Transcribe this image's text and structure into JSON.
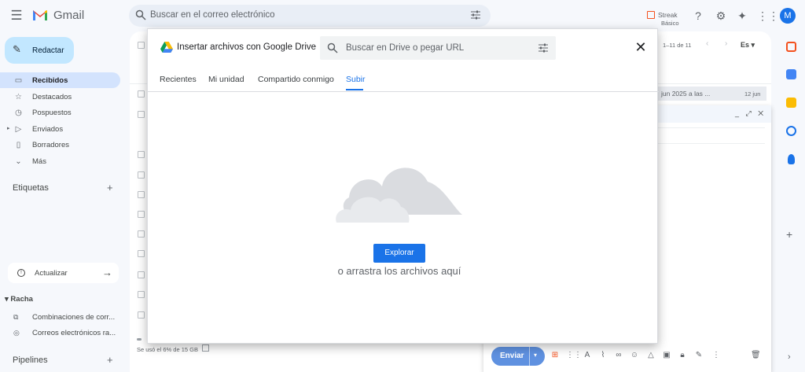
{
  "app": {
    "name": "Gmail",
    "avatar_letter": "M"
  },
  "search": {
    "placeholder": "Buscar en el correo electrónico"
  },
  "streak": {
    "title": "Streak",
    "subtitle": "Básico"
  },
  "compose": {
    "label": "Redactar"
  },
  "sidebar": {
    "items": [
      {
        "label": "Recibidos",
        "icon": "inbox-icon",
        "active": true
      },
      {
        "label": "Destacados",
        "icon": "star-icon"
      },
      {
        "label": "Pospuestos",
        "icon": "clock-icon"
      },
      {
        "label": "Enviados",
        "icon": "send-icon"
      },
      {
        "label": "Borradores",
        "icon": "draft-icon"
      },
      {
        "label": "Más",
        "icon": "chevron-down-icon"
      }
    ],
    "labels_title": "Etiquetas",
    "update_label": "Actualizar",
    "racha_title": "Racha",
    "racha_items": [
      {
        "label": "Combinaciones de corr..."
      },
      {
        "label": "Correos electrónicos ra..."
      }
    ],
    "pipelines_title": "Pipelines"
  },
  "list": {
    "pager": "1–11 de 11",
    "lang": "Es",
    "row_preview": "jun 2025 a las ...",
    "row_date": "12 jun",
    "storage": "Se usó el 6% de 15 GB"
  },
  "composer": {
    "send_label": "Enviar"
  },
  "modal": {
    "title": "Insertar archivos con Google Drive",
    "search_placeholder": "Buscar en Drive o pegar URL",
    "tabs": [
      {
        "label": "Recientes"
      },
      {
        "label": "Mi unidad"
      },
      {
        "label": "Compartido conmigo"
      },
      {
        "label": "Subir",
        "active": true
      }
    ],
    "browse_label": "Explorar",
    "drag_text": "o arrastra los archivos aquí"
  },
  "colors": {
    "accent": "#1a73e8",
    "compose_bg": "#c2e7ff",
    "active_nav": "#d3e3fd"
  }
}
